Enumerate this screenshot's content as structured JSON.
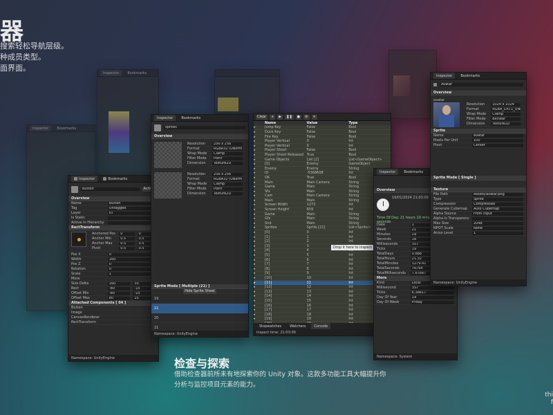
{
  "hero": {
    "title": "器",
    "lines": [
      "搜索轻松导航层级。",
      "种成员类型。",
      "面界面。"
    ]
  },
  "feature": {
    "title": "检查与探索",
    "line1": "借助检查器前所未有地探索你的 Unity 对象。这款多功能工具大幅提升你",
    "line2": "分析与监控项目元素的能力。"
  },
  "edge_text": [
    "thi",
    "f"
  ],
  "tabs": {
    "inspector": "Inspector",
    "bookmarks": "Bookmarks"
  },
  "main_window": {
    "toolbar": {
      "clear": "Clear"
    },
    "columns": [
      "Name",
      "Value",
      "Type"
    ],
    "rows": [
      [
        "Jump Key",
        "False",
        "Bool"
      ],
      [
        "Duck Key",
        "False",
        "Bool"
      ],
      [
        "Fire Key",
        "False",
        "Bool"
      ],
      [
        "Player Vertical",
        "0",
        "Int"
      ],
      [
        "Player Vertical",
        "0",
        "Int"
      ],
      [
        "Player Shoot",
        "False",
        "Bool"
      ],
      [
        "Player Shoot Released",
        "True",
        "Bool"
      ],
      [
        "Game Objects",
        "List [2]",
        "List<GameObject>"
      ],
      [
        "[0]",
        "Enemy",
        "GameObject"
      ],
      [
        "Enemy",
        "Enemy",
        "String"
      ],
      [
        "ID",
        "-5368608",
        "Int"
      ],
      [
        "OK",
        "True",
        "Bool"
      ],
      [
        "Main",
        "Main Camera",
        "String"
      ],
      [
        "Game",
        "Main",
        "String"
      ],
      [
        "Sfx",
        "Main",
        "String"
      ],
      [
        "Cam",
        "Main Camera",
        "String"
      ],
      [
        "Main",
        "Main",
        "String"
      ],
      [
        "Screen Width",
        "1273",
        "Int"
      ],
      [
        "Screen Height",
        "859",
        "Int"
      ],
      [
        "Game",
        "Main",
        "String"
      ],
      [
        "Gfx",
        "Main",
        "String"
      ],
      [
        "Snd",
        "Main",
        "String"
      ],
      [
        "Sprites",
        "Sprite [21]",
        "List<Sprite>"
      ],
      [
        "[0]",
        "0",
        "Int"
      ],
      [
        "[1]",
        "1",
        "Int"
      ],
      [
        "[2]",
        "2",
        "Int"
      ],
      [
        "[3]",
        "3",
        "Int"
      ],
      [
        "[4]",
        "4",
        "Int"
      ],
      [
        "[5]",
        "5",
        "Int"
      ],
      [
        "[6]",
        "6",
        "Int"
      ],
      [
        "[7]",
        "7",
        "Int"
      ],
      [
        "[8]",
        "8",
        "Int"
      ],
      [
        "[9]",
        "9",
        "Int"
      ],
      [
        "[10]",
        "10",
        "Int"
      ],
      [
        "[11]",
        "11",
        "Int"
      ],
      [
        "[12]",
        "12",
        "Int"
      ],
      [
        "[13]",
        "13",
        "Int"
      ],
      [
        "[14]",
        "14",
        "Int"
      ],
      [
        "[15]",
        "15",
        "Int"
      ],
      [
        "[16]",
        "16",
        "Int"
      ],
      [
        "[17]",
        "17",
        "Int"
      ],
      [
        "[18]",
        "18",
        "Int"
      ],
      [
        "[19]",
        "19",
        "Int"
      ],
      [
        "[20]",
        "20",
        "Int"
      ]
    ],
    "tooltip": "Drop it here to inspect",
    "bottom_tabs": [
      "Stopwatches",
      "Watchers",
      "Console"
    ],
    "inspect_time": "Inspect time: 21:03:09"
  },
  "left_window": {
    "name": "Button",
    "active": "Active",
    "rows": [
      [
        "Name",
        "Button"
      ],
      [
        "Tag",
        "Untagged"
      ],
      [
        "Layer",
        "UI"
      ],
      [
        "Is Static",
        ""
      ],
      [
        "Active In Hierarchy",
        ""
      ]
    ],
    "rect": "RectTransform",
    "anchors": [
      [
        "Anchored Pos",
        "0",
        "0"
      ],
      [
        "Anchor Min",
        "0.5",
        "0.5"
      ],
      [
        "Anchor Max",
        "0.5",
        "0.5"
      ],
      [
        "Pivot",
        "0.5",
        "0.5"
      ]
    ],
    "pos": [
      [
        "Pos X",
        "0"
      ],
      [
        "Width",
        "160"
      ],
      [
        "Pos Z",
        "0"
      ],
      [
        "Rotation",
        "0"
      ],
      [
        "Scale",
        "1"
      ]
    ],
    "more": "More",
    "size": [
      [
        "Size Delta",
        "160",
        "30"
      ],
      [
        "Rect",
        "-80",
        "-15"
      ],
      [
        "Offset Min",
        "-80",
        "-15"
      ],
      [
        "Offset Max",
        "80",
        "15"
      ]
    ],
    "attached_title": "Attached Components [ 04 ]",
    "attached": [
      "Button",
      "Image",
      "CanvasRenderer",
      "RectTransform"
    ],
    "namespace": "Namespace: UnityEngine"
  },
  "sprite_window": {
    "name": "sprites",
    "overview": "Overview",
    "specs": [
      [
        "Resolution",
        "256 x 256"
      ],
      [
        "Format",
        "RGBA32 (UNorm)"
      ],
      [
        "Wrap Mode",
        "Clamp"
      ],
      [
        "Filter Mode",
        "Point"
      ],
      [
        "Dimension",
        "Texture2D"
      ]
    ],
    "sprite_mode": "Sprite Mode [ Multiple (21) ]",
    "hide": "Hide Sprite Sheet",
    "items": [
      "19",
      "11",
      "20",
      "21"
    ],
    "namespace": "Namespace: UnityEngine"
  },
  "time_window": {
    "date": "19/01/2024 21:03:09",
    "uptime": "Time Of Day: 21 hours 19 minutes 8 seconds",
    "rows": [
      [
        "Date",
        "1"
      ],
      [
        "Week",
        "21"
      ],
      [
        "Minutes",
        "19"
      ],
      [
        "Seconds",
        "18"
      ],
      [
        "Milliseconds",
        "357"
      ],
      [
        "Ticks",
        "19"
      ],
      [
        "TotalDays",
        "0.888"
      ],
      [
        "TotalHours",
        "21.32"
      ],
      [
        "TotalMinutes",
        "1279.41"
      ],
      [
        "TotalSeconds",
        "76764"
      ],
      [
        "TotalMilliseconds",
        "7.676e7"
      ]
    ],
    "more": "More",
    "more_rows": [
      [
        "Kind",
        "Local"
      ],
      [
        "Millisecond",
        "357"
      ],
      [
        "Ticks",
        "6.38e17"
      ],
      [
        "Day Of Year",
        "19"
      ],
      [
        "Day Of Week",
        "Friday"
      ]
    ],
    "namespace": "Namespace: System"
  },
  "avatar_window": {
    "name": "Avatar",
    "overview": "Overview",
    "image_name": "avatar",
    "specs": [
      [
        "Resolution",
        "1024 x 1024"
      ],
      [
        "Format",
        "RGBA_DXT1_UNorm"
      ],
      [
        "Wrap Mode",
        "Clamp"
      ],
      [
        "Filter Mode",
        "Bilinear"
      ],
      [
        "Dimension",
        "Texture2D"
      ]
    ],
    "sprite": "Sprite",
    "sprite_rows": [
      [
        "Name",
        "avatar"
      ],
      [
        "Pixels Per Unit",
        "100"
      ],
      [
        "Pivot",
        "Center"
      ]
    ],
    "sprite_mode": "Sprite Mode [ Single ]",
    "texture": "Texture",
    "texture_rows": [
      [
        "File Path",
        "Assets/avatar.png"
      ],
      [
        "Type",
        "Sprite"
      ],
      [
        "Compression",
        "Compressed"
      ],
      [
        "Generate Cubemap",
        "Auto Cubemap"
      ],
      [
        "Alpha Source",
        "From Input"
      ],
      [
        "Alpha Is Transparency",
        ""
      ],
      [
        "Max Size",
        "2048"
      ],
      [
        "NPOT Scale",
        "None"
      ],
      [
        "Aniso Level",
        "1"
      ]
    ],
    "namespace": "Namespace: UnityEngine"
  },
  "colors": {
    "selection": "#2f5a8a",
    "window_bg": "#2b2b2b",
    "header": "#3a3a3a"
  }
}
